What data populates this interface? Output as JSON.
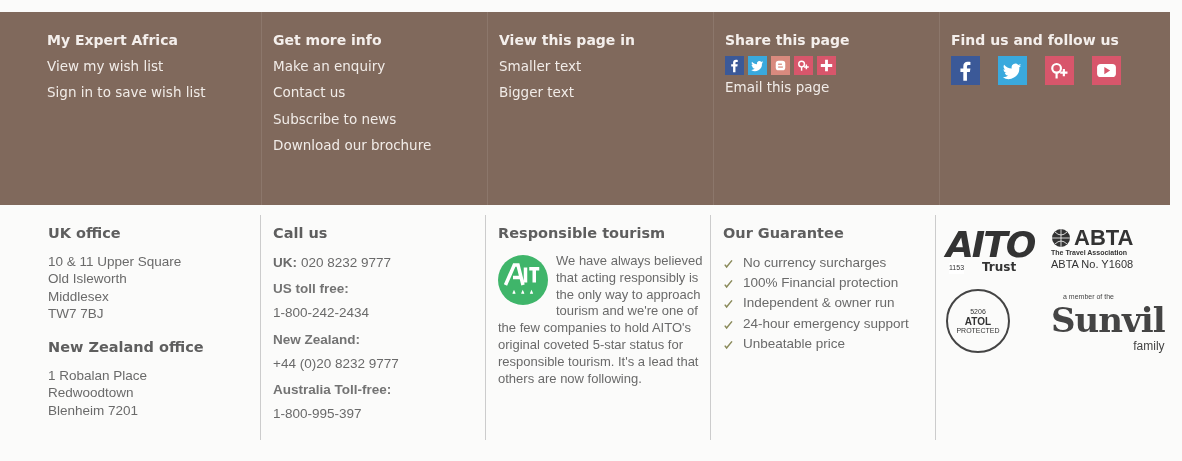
{
  "top_columns": [
    {
      "heading": "My Expert Africa",
      "links": [
        "View my wish list",
        "Sign in to save wish list"
      ]
    },
    {
      "heading": "Get more info",
      "links": [
        "Make an enquiry",
        "Contact us",
        "Subscribe to news",
        "Download our brochure"
      ]
    },
    {
      "heading": "View this page in",
      "links": [
        "Smaller text",
        "Bigger text"
      ]
    },
    {
      "heading": "Share this page",
      "share_icons": [
        {
          "kind": "facebook"
        },
        {
          "kind": "twitter"
        },
        {
          "kind": "blogger"
        },
        {
          "kind": "googleplus"
        },
        {
          "kind": "plus"
        }
      ],
      "links": [
        "Email this page"
      ]
    },
    {
      "heading": "Find us and follow us",
      "follow_icons": [
        {
          "kind": "facebook"
        },
        {
          "kind": "twitter"
        },
        {
          "kind": "googleplus"
        },
        {
          "kind": "youtube"
        }
      ]
    }
  ],
  "offices": [
    {
      "heading": "UK office",
      "lines": [
        "10 & 11 Upper Square",
        "Old Isleworth",
        "Middlesex",
        "TW7 7BJ"
      ]
    },
    {
      "heading": "New Zealand office",
      "lines": [
        "1 Robalan Place",
        "Redwoodtown",
        "Blenheim 7201"
      ]
    }
  ],
  "call_us": {
    "heading": "Call us",
    "entries": [
      {
        "kind": "inline",
        "label": "UK:",
        "number": "020 8232 9777"
      },
      {
        "kind": "stacked",
        "label": "US toll free:",
        "number": "1-800-242-2434"
      },
      {
        "kind": "stacked",
        "label": "New Zealand:",
        "number": "+44 (0)20 8232 9777"
      },
      {
        "kind": "stacked",
        "label": "Australia Toll-free:",
        "number": "1-800-995-397"
      }
    ]
  },
  "responsible": {
    "heading": "Responsible tourism",
    "text": "We have always believed that acting responsibly is the only way to approach tourism and we're one of the few companies to hold AITO's original coveted 5-star status for responsible tourism. It's a lead that others are now following."
  },
  "guarantee": {
    "heading": "Our Guarantee",
    "items": [
      "No currency surcharges",
      "100% Financial protection",
      "Independent & owner run",
      "24-hour emergency support",
      "Unbeatable price"
    ]
  },
  "logos": {
    "aito": {
      "name": "AITO",
      "number": "1153",
      "word": "Trust"
    },
    "abta": {
      "name": "ABTA",
      "tagline": "The Travel Association",
      "number": "ABTA No. Y1608"
    },
    "atol": {
      "number": "5206",
      "name": "ATOL",
      "label": "PROTECTED"
    },
    "sunvil": {
      "prefix": "a member of the",
      "name": "Sunvil",
      "suffix": "family"
    }
  }
}
